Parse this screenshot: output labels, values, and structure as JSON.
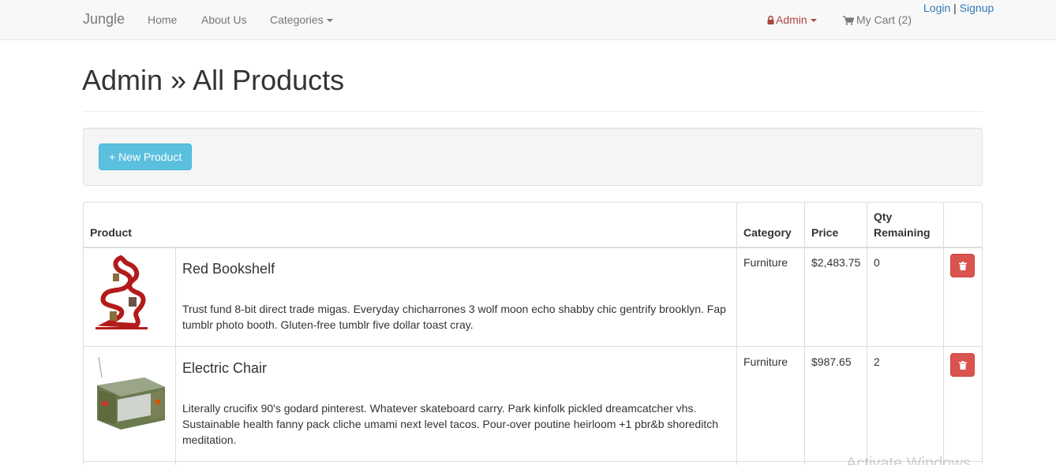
{
  "navbar": {
    "brand": "Jungle",
    "links": [
      "Home",
      "About Us",
      "Categories"
    ],
    "admin_label": "Admin",
    "cart_label": "My Cart (2)",
    "login_label": "Login",
    "auth_separator": "|",
    "signup_label": "Signup"
  },
  "page": {
    "title": "Admin » All Products"
  },
  "toolbar": {
    "new_product_label": "+ New Product"
  },
  "table": {
    "headers": {
      "product": "Product",
      "category": "Category",
      "price": "Price",
      "qty_line1": "Qty",
      "qty_line2": "Remaining"
    },
    "rows": [
      {
        "name": "Red Bookshelf",
        "description": "Trust fund 8-bit direct trade migas. Everyday chicharrones 3 wolf moon echo shabby chic gentrify brooklyn. Fap tumblr photo booth. Gluten-free tumblr five dollar toast cray.",
        "category": "Furniture",
        "price": "$2,483.75",
        "qty": "0"
      },
      {
        "name": "Electric Chair",
        "description": "Literally crucifix 90's godard pinterest. Whatever skateboard carry. Park kinfolk pickled dreamcatcher vhs. Sustainable health fanny pack cliche umami next level tacos. Pour-over poutine heirloom +1 pbr&b shoreditch meditation.",
        "category": "Furniture",
        "price": "$987.65",
        "qty": "2"
      }
    ]
  },
  "overlay": {
    "watermark": "Activate Windows"
  },
  "colors": {
    "navbar_bg": "#f8f8f8",
    "admin_red": "#a94442",
    "link_blue": "#337ab7",
    "info_button": "#5bc0de",
    "danger_button": "#d9534f"
  },
  "icons": {
    "admin": "lock-icon",
    "cart": "shopping-cart-icon",
    "delete": "trash-icon",
    "dropdown": "caret-down-icon"
  }
}
